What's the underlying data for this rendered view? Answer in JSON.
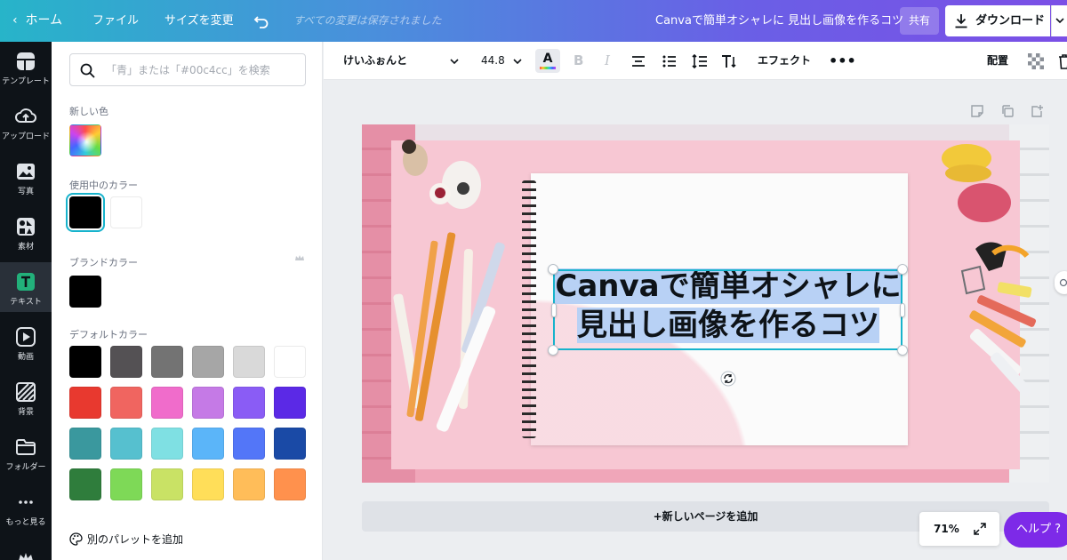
{
  "topbar": {
    "home": "ホーム",
    "file": "ファイル",
    "resize": "サイズを変更",
    "saved_status": "すべての変更は保存されました",
    "doc_title": "Canvaで簡単オシャレに 見出し画像を作るコツ",
    "share": "共有",
    "download": "ダウンロード"
  },
  "rail": {
    "items": [
      {
        "label": "テンプレート",
        "icon": "template-icon"
      },
      {
        "label": "アップロード",
        "icon": "upload-icon"
      },
      {
        "label": "写真",
        "icon": "photo-icon"
      },
      {
        "label": "素材",
        "icon": "elements-icon"
      },
      {
        "label": "テキスト",
        "icon": "text-icon"
      },
      {
        "label": "動画",
        "icon": "video-icon"
      },
      {
        "label": "背景",
        "icon": "background-icon"
      },
      {
        "label": "フォルダー",
        "icon": "folder-icon"
      },
      {
        "label": "もっと見る",
        "icon": "more-icon"
      }
    ]
  },
  "panel": {
    "search_placeholder": "「青」または「#00c4cc」を検索",
    "new_color_label": "新しい色",
    "in_use_label": "使用中のカラー",
    "brand_label": "ブランドカラー",
    "default_label": "デフォルトカラー",
    "add_palette": "別のパレットを追加",
    "in_use_colors": [
      "#000000",
      "#ffffff"
    ],
    "brand_colors": [
      "#000000"
    ],
    "default_colors": [
      "#000000",
      "#545154",
      "#737373",
      "#a6a6a6",
      "#d9d9d9",
      "#ffffff",
      "#e8392f",
      "#f06560",
      "#f06ccb",
      "#c57ae6",
      "#8a5cf5",
      "#5b29e6",
      "#3a989e",
      "#56c0cf",
      "#7fe0e3",
      "#5bb5f9",
      "#5376f8",
      "#1a4aa6",
      "#2f7d3c",
      "#7ed957",
      "#c9e265",
      "#ffde59",
      "#ffbd59",
      "#ff914d"
    ]
  },
  "toolbar": {
    "font_name": "けいふぉんと",
    "font_size": "44.8",
    "effects": "エフェクト",
    "position": "配置"
  },
  "canvas": {
    "headline_line1": "Canvaで簡単オシャレに",
    "headline_line2": "見出し画像を作るコツ",
    "add_page": "+新しいページを追加"
  },
  "footer": {
    "zoom": "71%",
    "help": "ヘルプ ?"
  }
}
